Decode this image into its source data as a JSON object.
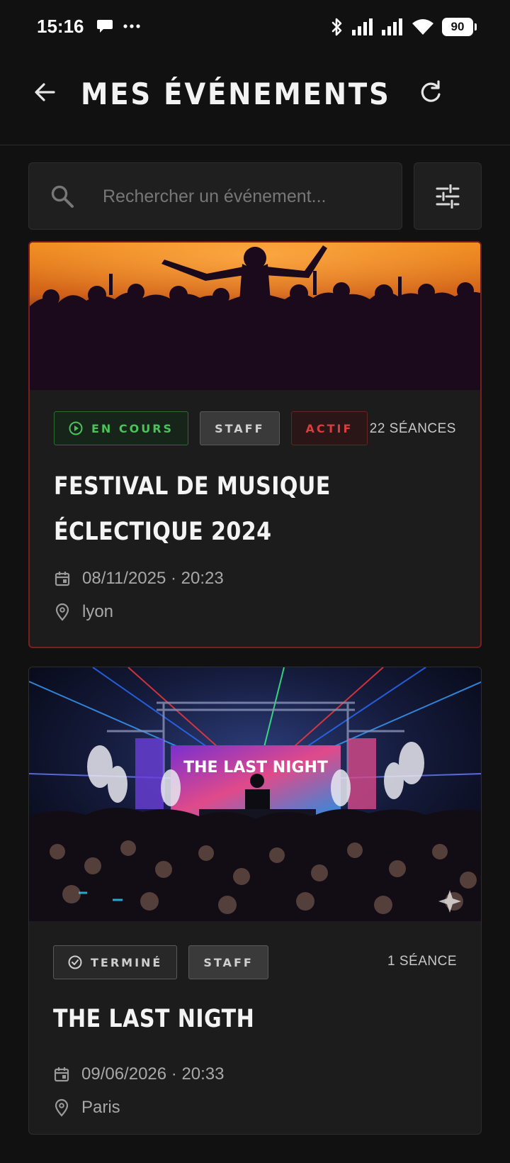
{
  "status_bar": {
    "time": "15:16",
    "battery": "90"
  },
  "header": {
    "title": "MES ÉVÉNEMENTS"
  },
  "search": {
    "placeholder": "Rechercher un événement..."
  },
  "events": [
    {
      "status_badge": "EN COURS",
      "role_badge": "STAFF",
      "state_badge": "ACTIF",
      "sessions": "22 SÉANCES",
      "title": "FESTIVAL DE MUSIQUE ÉCLECTIQUE 2024",
      "date": "08/11/2025 · 20:23",
      "location": "lyon"
    },
    {
      "status_badge": "TERMINÉ",
      "role_badge": "STAFF",
      "sessions": "1 SÉANCE",
      "title": "THE LAST NIGTH",
      "screen_text": "THE LAST NIGHT",
      "date": "09/06/2026 · 20:33",
      "location": "Paris"
    }
  ],
  "colors": {
    "background": "#111111",
    "card": "#1c1c1c",
    "active_green": "#4bc25a",
    "active_red": "#d93d3d"
  }
}
